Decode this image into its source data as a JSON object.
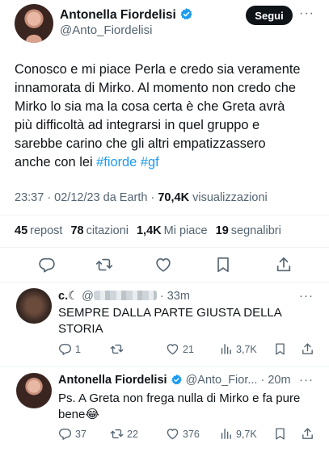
{
  "main_tweet": {
    "author_name": "Antonella Fiordelisi",
    "handle": "@Anto_Fiordelisi",
    "follow_label": "Segui",
    "text_lines": [
      "Conosco e mi piace Perla e credo sia veramente",
      "innamorata di Mirko. Al momento non credo che",
      "Mirko lo sia ma la cosa certa è che Greta avrà",
      "più difficoltà ad integrarsi in quel gruppo e",
      "sarebbe carino che gli altri empatizzassero",
      "anche con lei"
    ],
    "hashtags": [
      "#fiorde",
      "#gf"
    ],
    "time_date": "23:37 · 02/12/23 da Earth ·",
    "views_count": "70,4K",
    "views_label": "visualizzazioni",
    "stats": {
      "reposts_count": "45",
      "reposts_label": "repost",
      "quotes_count": "78",
      "quotes_label": "citazioni",
      "likes_count": "1,4K",
      "likes_label": "Mi piace",
      "bookmarks_count": "19",
      "bookmarks_label": "segnalibri"
    }
  },
  "replies": [
    {
      "name": "c.☾",
      "handle_prefix": "@",
      "time": "· 33m",
      "text_lines": [
        "SEMPRE DALLA PARTE GIUSTA DELLA",
        "STORIA"
      ],
      "replies_count": "1",
      "reposts_count": "",
      "likes_count": "21",
      "views_count": "3,7K"
    },
    {
      "name": "Antonella Fiordelisi",
      "handle": "@Anto_Fior...",
      "time": "· 20m",
      "text_lines": [
        "Ps. A Greta non frega nulla di Mirko e fa pure",
        "bene😂"
      ],
      "replies_count": "37",
      "reposts_count": "22",
      "likes_count": "376",
      "views_count": "9,7K"
    }
  ],
  "colors": {
    "accent": "#1d9bf0",
    "text": "#0f1419",
    "secondary": "#536471",
    "divider": "#eff3f4"
  },
  "icons": [
    "verified-badge-icon",
    "more-icon",
    "reply-icon",
    "repost-icon",
    "like-icon",
    "bookmark-icon",
    "share-icon",
    "views-icon"
  ]
}
